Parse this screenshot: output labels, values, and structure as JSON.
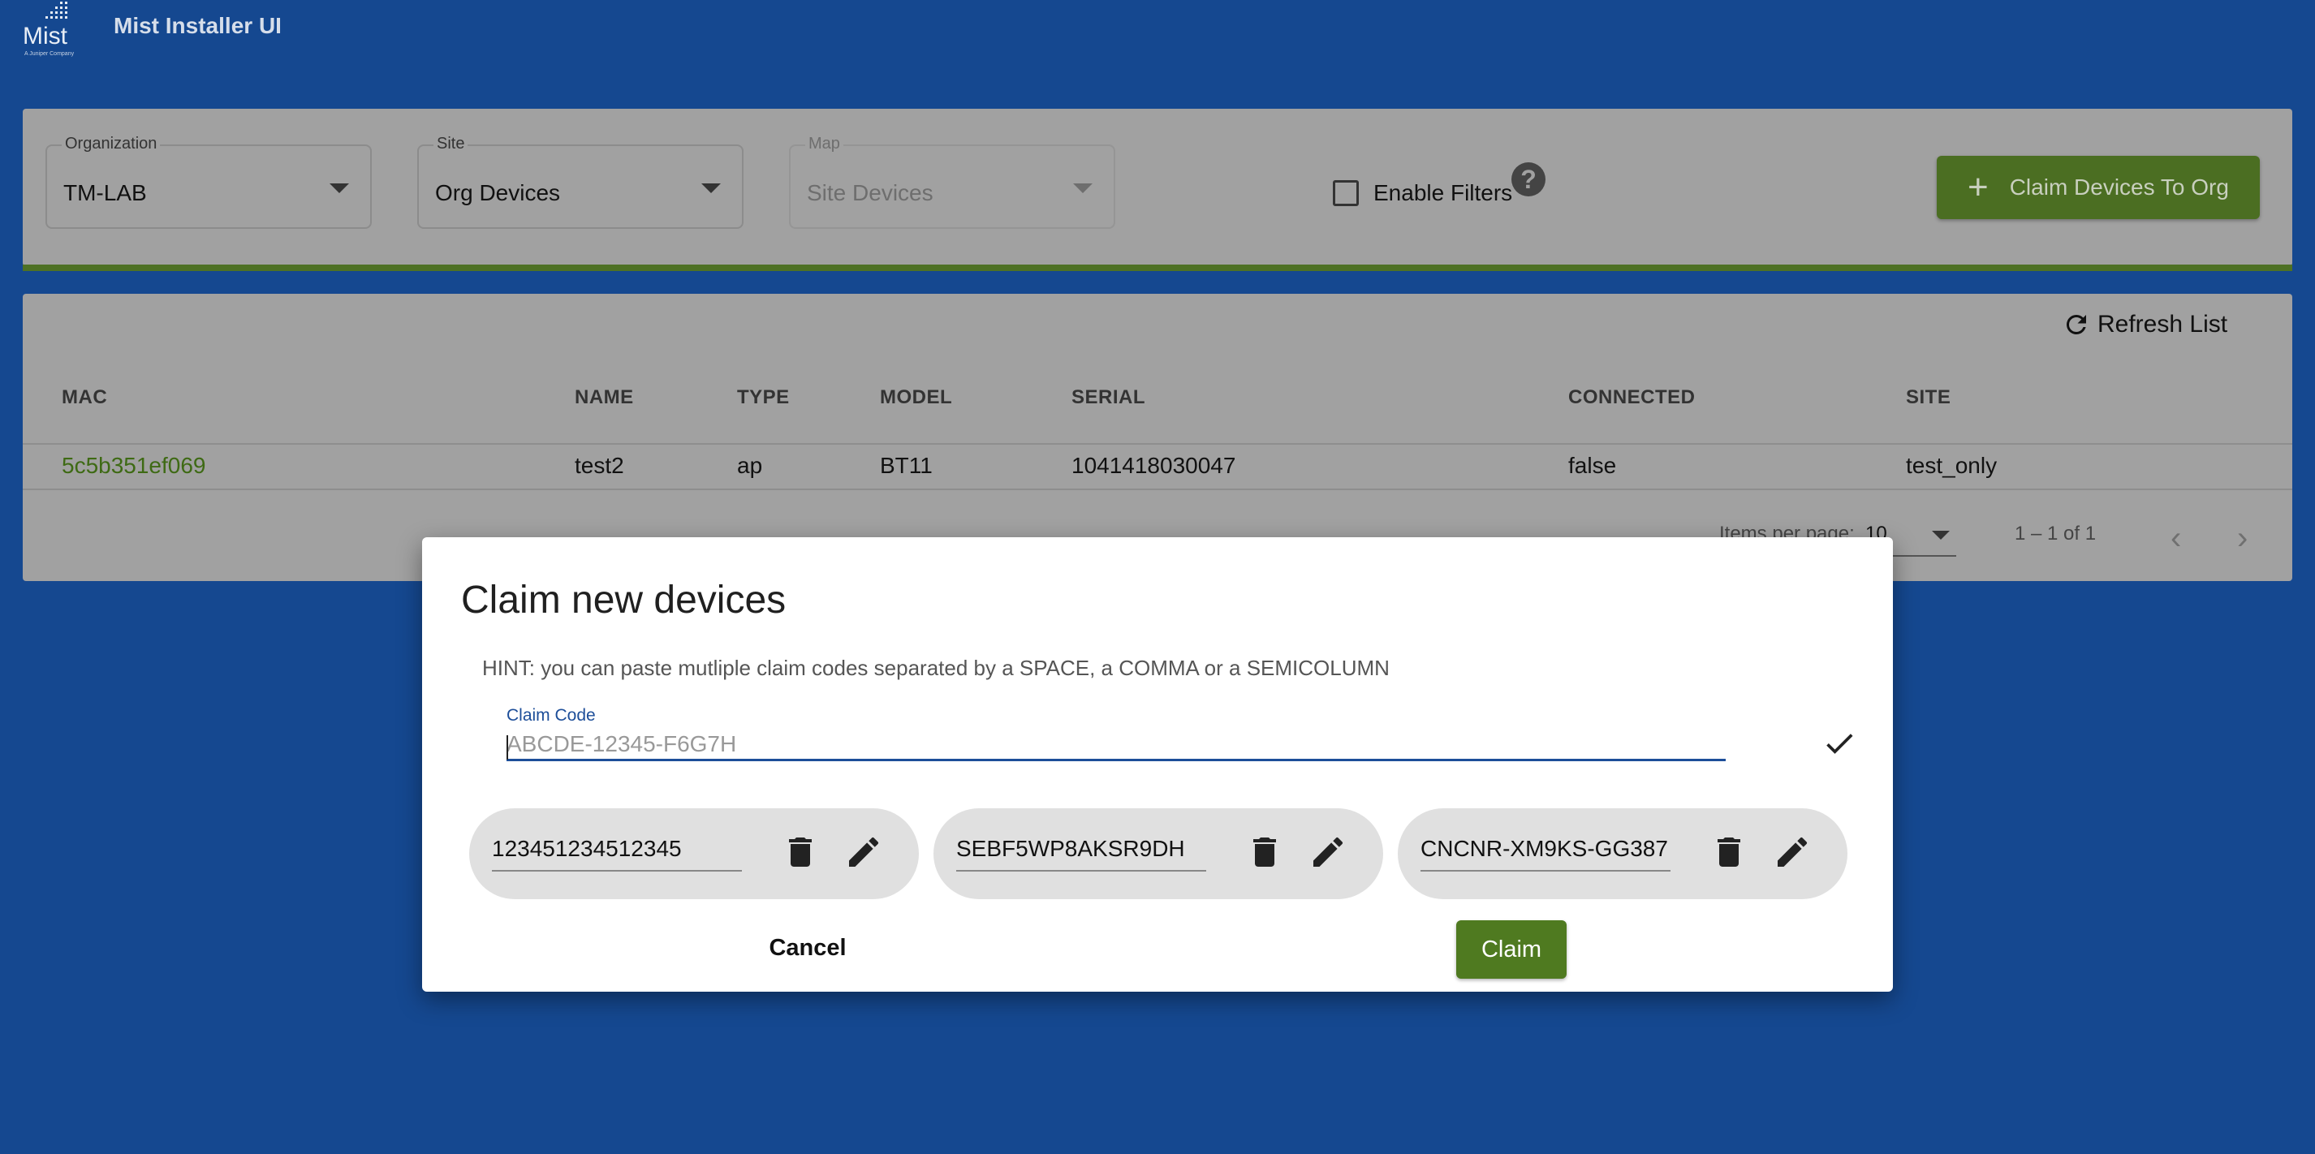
{
  "header": {
    "logo_text": "Mist",
    "logo_subtext": "A Juniper Company",
    "title": "Mist Installer UI"
  },
  "filters": {
    "organization": {
      "label": "Organization",
      "value": "TM-LAB"
    },
    "site": {
      "label": "Site",
      "value": "Org Devices"
    },
    "map": {
      "label": "Map",
      "value": "Site Devices"
    },
    "enable_filters_label": "Enable Filters",
    "claim_button_label": "Claim Devices To Org"
  },
  "table": {
    "refresh_label": "Refresh List",
    "columns": [
      "MAC",
      "NAME",
      "TYPE",
      "MODEL",
      "SERIAL",
      "CONNECTED",
      "SITE"
    ],
    "rows": [
      {
        "mac": "5c5b351ef069",
        "name": "test2",
        "type": "ap",
        "model": "BT11",
        "serial": "1041418030047",
        "connected": "false",
        "site": "test_only"
      }
    ],
    "paginator": {
      "items_per_page_label": "Items per page:",
      "page_size": "10",
      "range": "1 – 1 of 1"
    }
  },
  "dialog": {
    "title": "Claim new devices",
    "hint": "HINT: you can paste mutliple claim codes separated by a SPACE, a COMMA or a SEMICOLUMN",
    "claim_code_label": "Claim Code",
    "claim_code_placeholder": "ABCDE-12345-F6G7H",
    "codes": [
      "123451234512345",
      "SEBF5WP8AKSR9DH",
      "CNCNR-XM9KS-GG387"
    ],
    "cancel_label": "Cancel",
    "claim_label": "Claim"
  },
  "colors": {
    "background": "#154890",
    "accent_green": "#4f7a20",
    "primary_blue": "#1d4e99"
  }
}
